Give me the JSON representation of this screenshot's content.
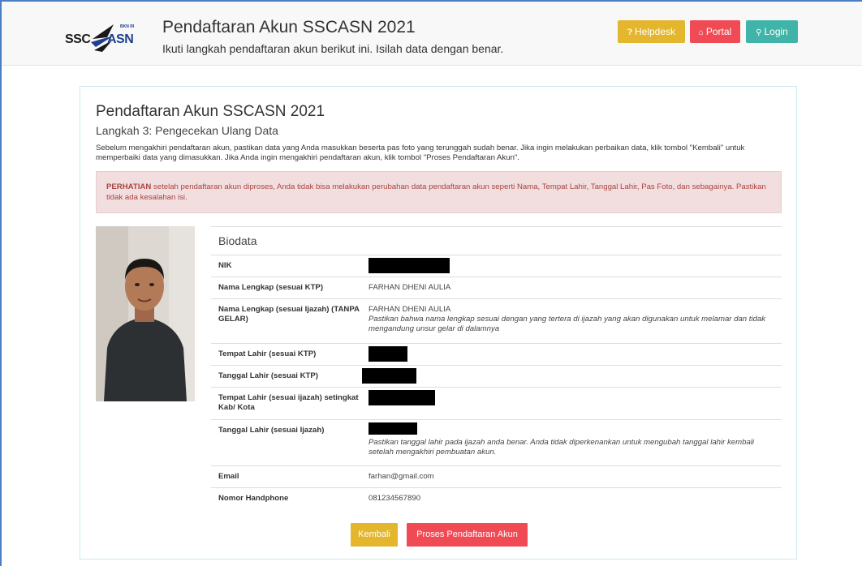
{
  "header": {
    "title": "Pendaftaran Akun SSCASN 2021",
    "subtitle": "Ikuti langkah pendaftaran akun berikut ini. Isilah data dengan benar.",
    "logo": {
      "ssc": "SSC",
      "asn": "ASN",
      "tag": "BKN RI"
    },
    "buttons": {
      "helpdesk": "Helpdesk",
      "portal": "Portal",
      "login": "Login"
    }
  },
  "panel": {
    "title": "Pendaftaran Akun SSCASN 2021",
    "step": "Langkah 3: Pengecekan Ulang Data",
    "intro": "Sebelum mengakhiri pendaftaran akun, pastikan data yang Anda masukkan beserta pas foto yang terunggah sudah benar. Jika ingin melakukan perbaikan data, klik tombol \"Kembali\" untuk memperbaiki data yang dimasukkan. Jika Anda ingin mengakhiri pendaftaran akun, klik tombol \"Proses Pendaftaran Akun\".",
    "alert_strong": "PERHATIAN",
    "alert_text": " setelah pendaftaran akun diproses, Anda tidak bisa melakukan perubahan data pendaftaran akun seperti Nama, Tempat Lahir, Tanggal Lahir, Pas Foto, dan sebagainya. Pastikan tidak ada kesalahan isi.",
    "biodata_heading": "Biodata",
    "rows": {
      "nik": {
        "label": "NIK"
      },
      "nama_ktp": {
        "label": "Nama Lengkap (sesuai KTP)",
        "value": "FARHAN DHENI AULIA"
      },
      "nama_ijazah": {
        "label": "Nama Lengkap (sesuai Ijazah) (TANPA GELAR)",
        "value": "FARHAN DHENI AULIA",
        "note": "Pastikan bahwa nama lengkap sesuai dengan yang tertera di ijazah yang akan digunakan untuk melamar dan tidak mengandung unsur gelar di dalamnya"
      },
      "tempat_ktp": {
        "label": "Tempat Lahir (sesuai KTP)"
      },
      "tanggal_ktp": {
        "label": "Tanggal Lahir (sesuai KTP)"
      },
      "tempat_ijazah": {
        "label": "Tempat Lahir (sesuai ijazah) setingkat Kab/ Kota"
      },
      "tanggal_ijazah": {
        "label": "Tanggal Lahir (sesuai Ijazah)",
        "note": "Pastikan tanggal lahir pada ijazah anda benar. Anda tidak diperkenankan untuk mengubah tanggal lahir kembali setelah mengakhiri pembuatan akun."
      },
      "email": {
        "label": "Email",
        "value": "farhan@gmail.com"
      },
      "hp": {
        "label": "Nomor Handphone",
        "value": "081234567890"
      }
    },
    "buttons": {
      "back": "Kembali",
      "process": "Proses Pendaftaran Akun"
    }
  },
  "colors": {
    "warning": "#e3b62e",
    "danger": "#f04a55",
    "info": "#40b4a8",
    "alert_bg": "#f2dede",
    "alert_text": "#a94442"
  }
}
